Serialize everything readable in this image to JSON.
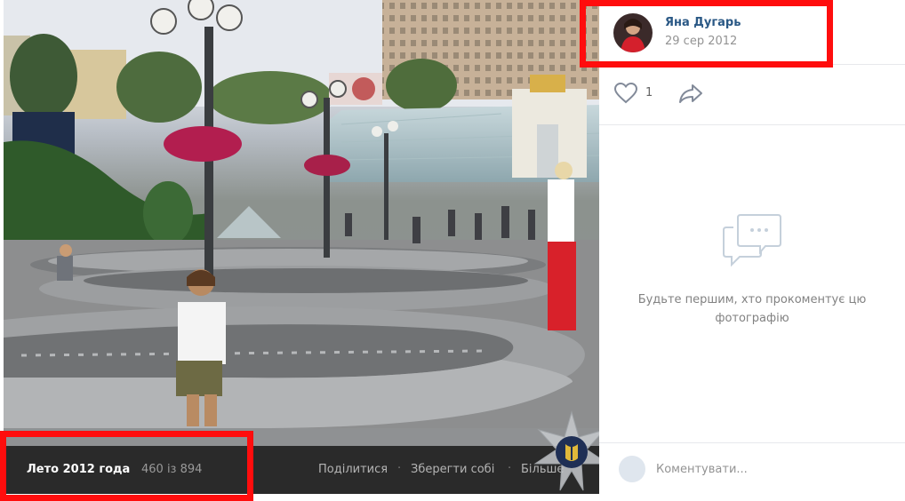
{
  "author": {
    "name": "Яна Дугарь",
    "date": "29 сер 2012",
    "avatar_icon": "user-avatar"
  },
  "actions": {
    "like_count": "1",
    "like_icon": "heart-icon",
    "share_icon": "share-arrow-icon"
  },
  "comments": {
    "empty_text": "Будьте першим, хто прокоментує цю фотографію",
    "empty_icon": "speech-bubbles-icon",
    "input_placeholder": "Коментувати..."
  },
  "album": {
    "title": "Лето 2012 года",
    "counter": "460 із 894"
  },
  "bottom_actions": {
    "share": "Поділитися",
    "save": "Зберегти собі",
    "more": "Більше",
    "separator": "·"
  },
  "colors": {
    "link_blue": "#2a5885",
    "highlight_red": "#ff0d0d",
    "bottom_bar": "#2a2a2a"
  }
}
